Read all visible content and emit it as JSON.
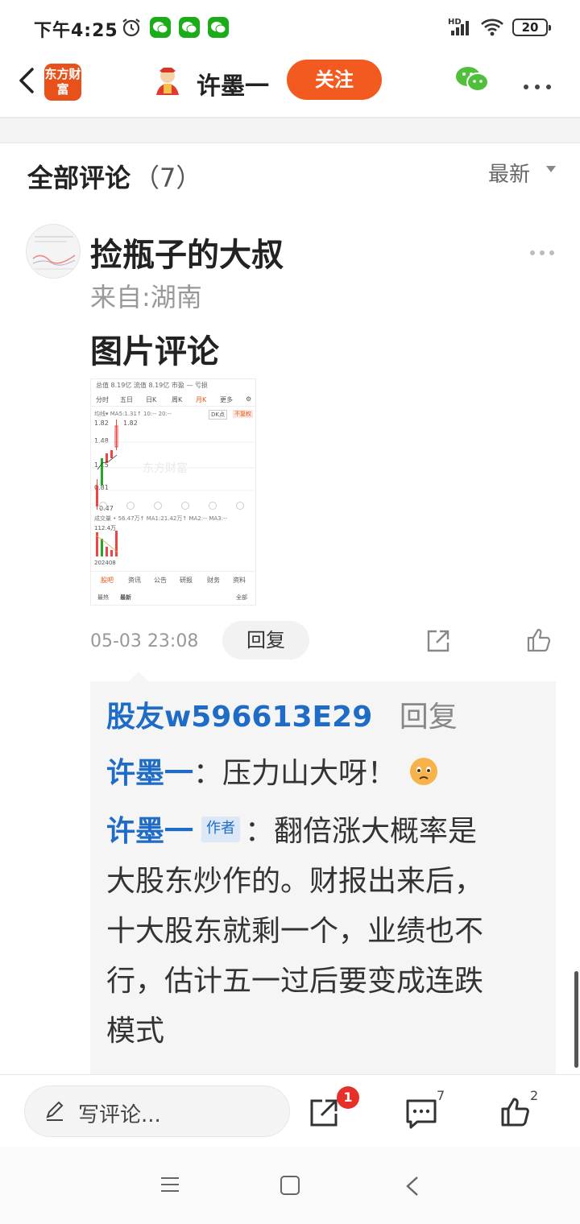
{
  "status_bar": {
    "time": "下午4:25",
    "network": "HD",
    "battery": "20"
  },
  "nav": {
    "logo_text": "东方财富",
    "title": "许墨一",
    "follow_label": "关注"
  },
  "section": {
    "title": "全部评论",
    "count": "（7）",
    "sort_label": "最新"
  },
  "comment": {
    "user": "捡瓶子的大叔",
    "location": "来自:湖南",
    "text": "图片评论",
    "time": "05-03 23:08",
    "reply_label": "回复",
    "thumbnail": {
      "top_stats": "总值  8.19亿  流值  8.19亿  市盈  —  亏损",
      "tabs": [
        "分时",
        "五日",
        "日K",
        "周K",
        "月K",
        "更多"
      ],
      "active_tab": "月K",
      "indicator": "均线▾  MA5:1.31↑  10:--  20:--",
      "dk_label": "DK点",
      "fq_label": "不复权",
      "y_labels": [
        "1.82",
        "1.48",
        "1.15",
        "0.81",
        "0.47"
      ],
      "high_label": "1.82",
      "low_label": "0.47",
      "watermark": "东方财富",
      "volume_label": "成交量 • 56.47万↑  MA1:21.42万↑  MA2:--  MA3:--",
      "volume_max": "112.4万",
      "date_label": "202408",
      "bottom_tabs": [
        "股吧",
        "资讯",
        "公告",
        "研报",
        "财务",
        "资料"
      ],
      "active_bottom_tab": "股吧",
      "sort_options": [
        "最热",
        "最新"
      ],
      "filter_label": "全部"
    }
  },
  "replies": {
    "header_user": "股友w596613E29",
    "header_action": "回复",
    "items": [
      {
        "user": "许墨一",
        "text": "：压力山大呀！"
      },
      {
        "user": "许墨一",
        "tag": "作者",
        "text_lines": [
          "：翻倍涨大概率是",
          "大股东炒作的。财报出来后，",
          "十大股东就剩一个，业绩也不",
          "行，估计五一过后要变成连跌",
          "模式"
        ]
      }
    ]
  },
  "bottom_bar": {
    "write_placeholder": "写评论...",
    "share_badge": "1",
    "comment_count": "7",
    "like_count": "2"
  },
  "colors": {
    "accent": "#f25a1f",
    "link": "#1f6cc7",
    "badge": "#e8302a"
  }
}
